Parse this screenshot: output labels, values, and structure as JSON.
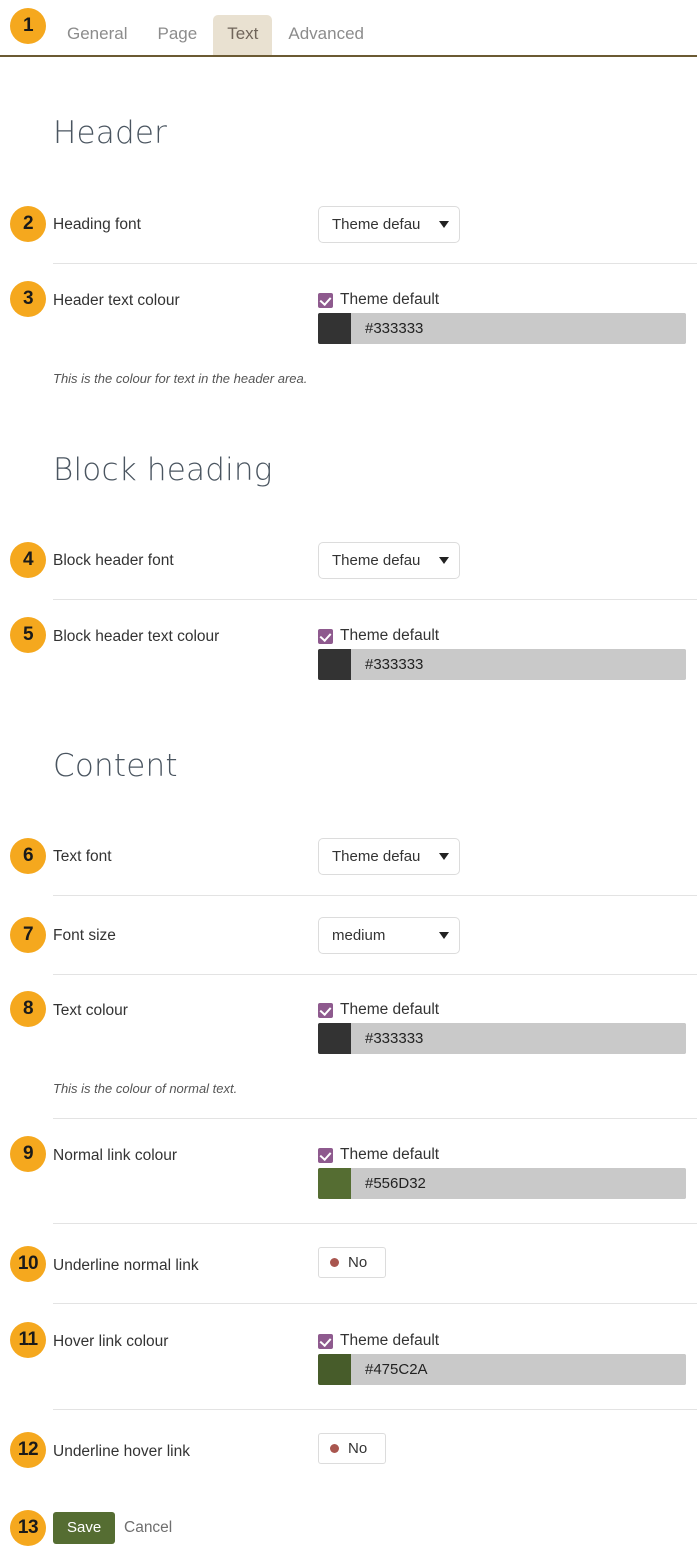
{
  "tabs": [
    {
      "label": "General",
      "active": false
    },
    {
      "label": "Page",
      "active": false
    },
    {
      "label": "Text",
      "active": true
    },
    {
      "label": "Advanced",
      "active": false
    }
  ],
  "sections": {
    "header": "Header",
    "block_heading": "Block heading",
    "content": "Content"
  },
  "badges": {
    "b1": "1",
    "b2": "2",
    "b3": "3",
    "b4": "4",
    "b5": "5",
    "b6": "6",
    "b7": "7",
    "b8": "8",
    "b9": "9",
    "b10": "10",
    "b11": "11",
    "b12": "12",
    "b13": "13"
  },
  "fields": {
    "heading_font": {
      "label": "Heading font",
      "value": "Theme defau"
    },
    "header_text_colour": {
      "label": "Header text colour",
      "checkbox_label": "Theme default",
      "checked": true,
      "colour": "#333333",
      "swatch": "#333333",
      "help": "This is the colour for text in the header area."
    },
    "block_header_font": {
      "label": "Block header font",
      "value": "Theme defau"
    },
    "block_header_text_colour": {
      "label": "Block header text colour",
      "checkbox_label": "Theme default",
      "checked": true,
      "colour": "#333333",
      "swatch": "#333333"
    },
    "text_font": {
      "label": "Text font",
      "value": "Theme defau"
    },
    "font_size": {
      "label": "Font size",
      "value": "medium"
    },
    "text_colour": {
      "label": "Text colour",
      "checkbox_label": "Theme default",
      "checked": true,
      "colour": "#333333",
      "swatch": "#333333",
      "help": "This is the colour of normal text."
    },
    "normal_link_colour": {
      "label": "Normal link colour",
      "checkbox_label": "Theme default",
      "checked": true,
      "colour": "#556D32",
      "swatch": "#556D32"
    },
    "underline_normal_link": {
      "label": "Underline normal link",
      "value": "No"
    },
    "hover_link_colour": {
      "label": "Hover link colour",
      "checkbox_label": "Theme default",
      "checked": true,
      "colour": "#475C2A",
      "swatch": "#475C2A"
    },
    "underline_hover_link": {
      "label": "Underline hover link",
      "value": "No"
    }
  },
  "footer": {
    "save_label": "Save",
    "cancel_label": "Cancel"
  },
  "colors": {
    "badge": "#F5A81E",
    "active_tab_bg": "#E9E1D1",
    "tab_underline": "#6B5A33",
    "checkbox": "#8E5A8E",
    "toggle_dot": "#A9564F",
    "save_button": "#556D32",
    "colour_field_bg": "#C9C9C9"
  }
}
